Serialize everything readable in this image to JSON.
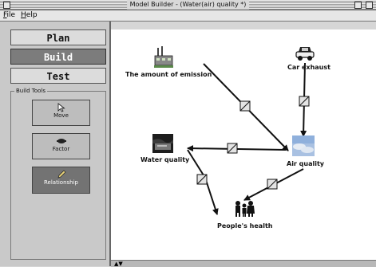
{
  "window": {
    "title": "Model Builder - (Water(air) quality *)"
  },
  "menu": {
    "file": {
      "underline": "F",
      "rest": "ile"
    },
    "help": {
      "underline": "H",
      "rest": "elp"
    }
  },
  "modes": [
    {
      "label": "Plan",
      "active": false
    },
    {
      "label": "Build",
      "active": true
    },
    {
      "label": "Test",
      "active": false
    }
  ],
  "build_tools": {
    "title": "Build Tools",
    "tools": [
      {
        "label": "Move",
        "icon": "cursor-icon",
        "active": false
      },
      {
        "label": "Factor",
        "icon": "factor-icon",
        "active": false
      },
      {
        "label": "Relationship",
        "icon": "pencil-icon",
        "active": true
      }
    ]
  },
  "nodes": {
    "emission": {
      "label": "The amount of emission",
      "icon": "factory-icon"
    },
    "car": {
      "label": "Car exhaust",
      "icon": "car-icon"
    },
    "water": {
      "label": "Water quality",
      "icon": "water-photo-icon"
    },
    "air": {
      "label": "Air quality",
      "icon": "sky-photo-icon"
    },
    "health": {
      "label": "People's health",
      "icon": "people-icon"
    }
  },
  "colors": {
    "accent_active": "#7c7c7c",
    "canvas": "#ffffff",
    "sidebar": "#c9c9c9"
  }
}
